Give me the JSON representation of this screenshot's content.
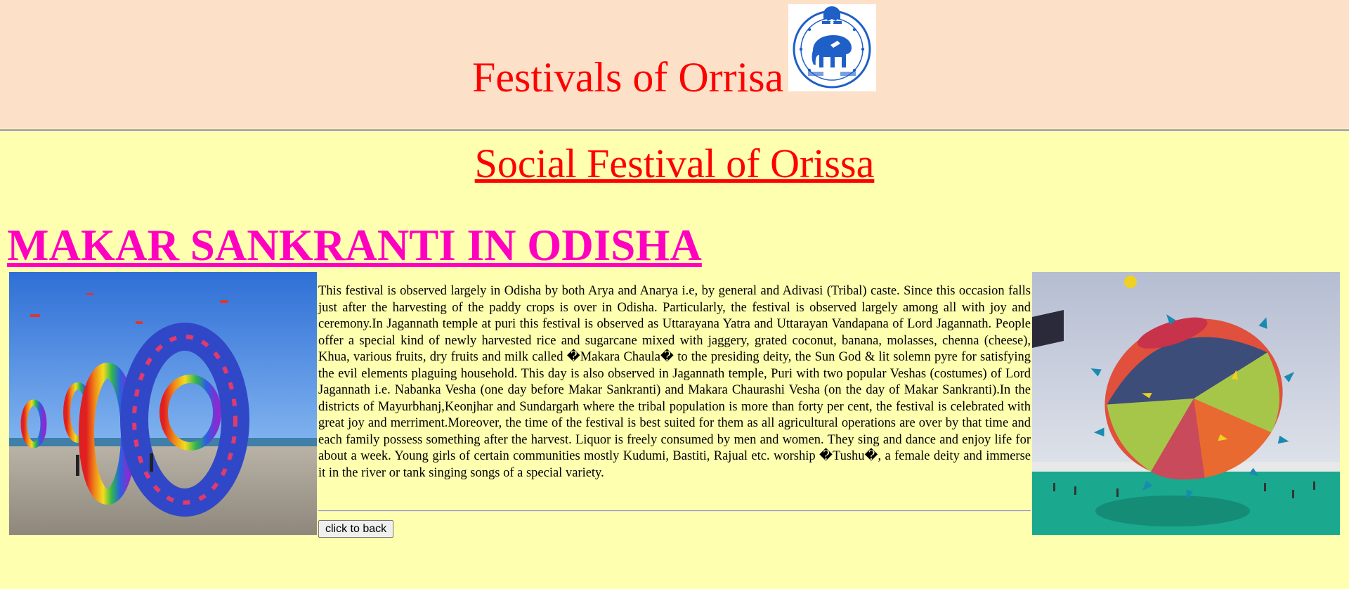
{
  "header": {
    "title": "Festivals of Orrisa",
    "emblem_icon": "odisha-state-emblem-icon"
  },
  "section": {
    "title": "Social Festival of Orissa"
  },
  "festival": {
    "title": "MAKAR SANKRANTI IN ODISHA",
    "left_image": "ring-kites-on-beach-photo",
    "right_image": "giant-spiked-kite-festival-photo",
    "description": "This festival is observed largely in Odisha by both Arya and Anarya i.e, by general and Adivasi (Tribal) caste. Since this occasion falls just after the harvesting of the paddy crops is over in Odisha. Particularly, the festival is observed largely among all with joy and ceremony.In Jagannath temple at puri this festival is observed as Uttarayana Yatra and Uttarayan Vandapana of Lord Jagannath. People offer a special kind of newly harvested rice and sugarcane mixed with jaggery, grated coconut, banana, molasses, chenna (cheese), Khua, various fruits, dry fruits and milk called �Makara Chaula� to the presiding deity, the Sun God & lit solemn pyre for satisfying the evil elements plaguing household. This day is also observed in Jagannath temple, Puri with two popular Veshas (costumes) of Lord Jagannath i.e. Nabanka Vesha (one day before Makar Sankranti) and Makara Chaurashi Vesha (on the day of Makar Sankranti).In the districts of Mayurbhanj,Keonjhar and Sundargarh where the tribal population is more than forty per cent, the festival is celebrated with great joy and merriment.Moreover, the time of the festival is best suited for them as all agricultural operations are over by that time and each family possess something after the harvest. Liquor is freely consumed by men and women. They sing and dance and enjoy life for about a week. Young girls of certain communities mostly Kudumi, Bastiti, Rajual etc. worship �Tushu�, a female deity and immerse it in the river or tank singing songs of a special variety."
  },
  "back_button": {
    "label": "click to back"
  },
  "colors": {
    "header_bg": "#fde0c8",
    "page_bg": "#ffffb0",
    "title_red": "#ff0000",
    "festival_magenta": "#ff00c0"
  }
}
